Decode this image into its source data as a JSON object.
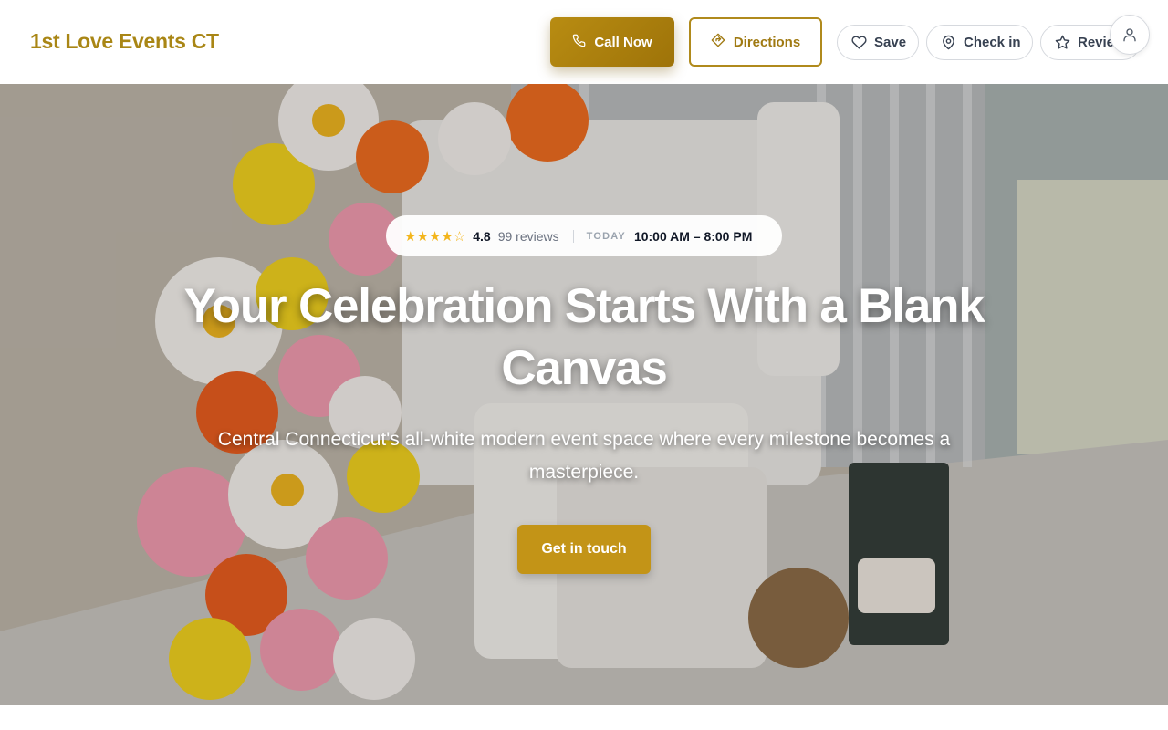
{
  "header": {
    "brand": "1st Love Events CT",
    "call_label": "Call Now",
    "directions_label": "Directions",
    "save_label": "Save",
    "checkin_label": "Check in",
    "reviews_label": "Reviews"
  },
  "hero": {
    "stars": "★★★★☆",
    "rating": "4.8",
    "review_count": "99 reviews",
    "today_label": "TODAY",
    "hours": "10:00 AM – 8:00 PM",
    "title": "Your Celebration Starts With a Blank Canvas",
    "subtitle": "Central Connecticut's all-white modern event space where every milestone becomes a masterpiece.",
    "cta_label": "Get in touch"
  },
  "colors": {
    "brand": "#a98615",
    "accent": "#c39417",
    "star": "#f3b51b"
  },
  "icons": {
    "call": "phone-icon",
    "directions": "directions-icon",
    "save": "heart-icon",
    "checkin": "location-pin-icon",
    "reviews": "star-icon",
    "account": "user-icon"
  }
}
